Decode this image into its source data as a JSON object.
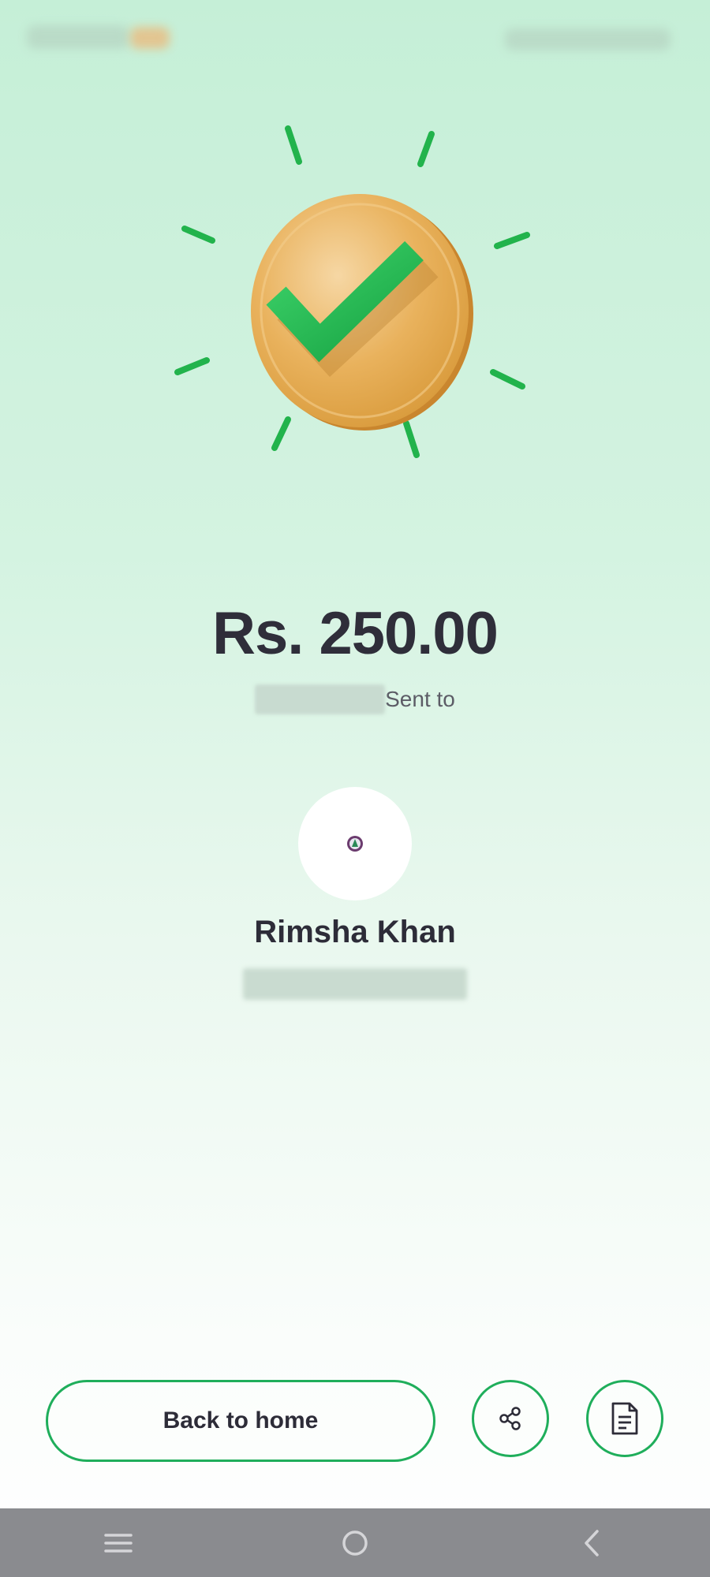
{
  "payment": {
    "amount": "Rs. 250.00",
    "sent_label": "Sent to"
  },
  "recipient": {
    "name": "Rimsha Khan"
  },
  "actions": {
    "back_home_label": "Back to home",
    "share_icon": "share-icon",
    "receipt_icon": "receipt-icon"
  },
  "colors": {
    "accent_green": "#1fae5b",
    "coin_gold": "#e9b25d",
    "text_dark": "#2d2c38",
    "nav_bar": "#8a8b8f"
  },
  "system_nav": {
    "icons": [
      "menu-icon",
      "home-circle-icon",
      "back-chevron-icon"
    ]
  }
}
